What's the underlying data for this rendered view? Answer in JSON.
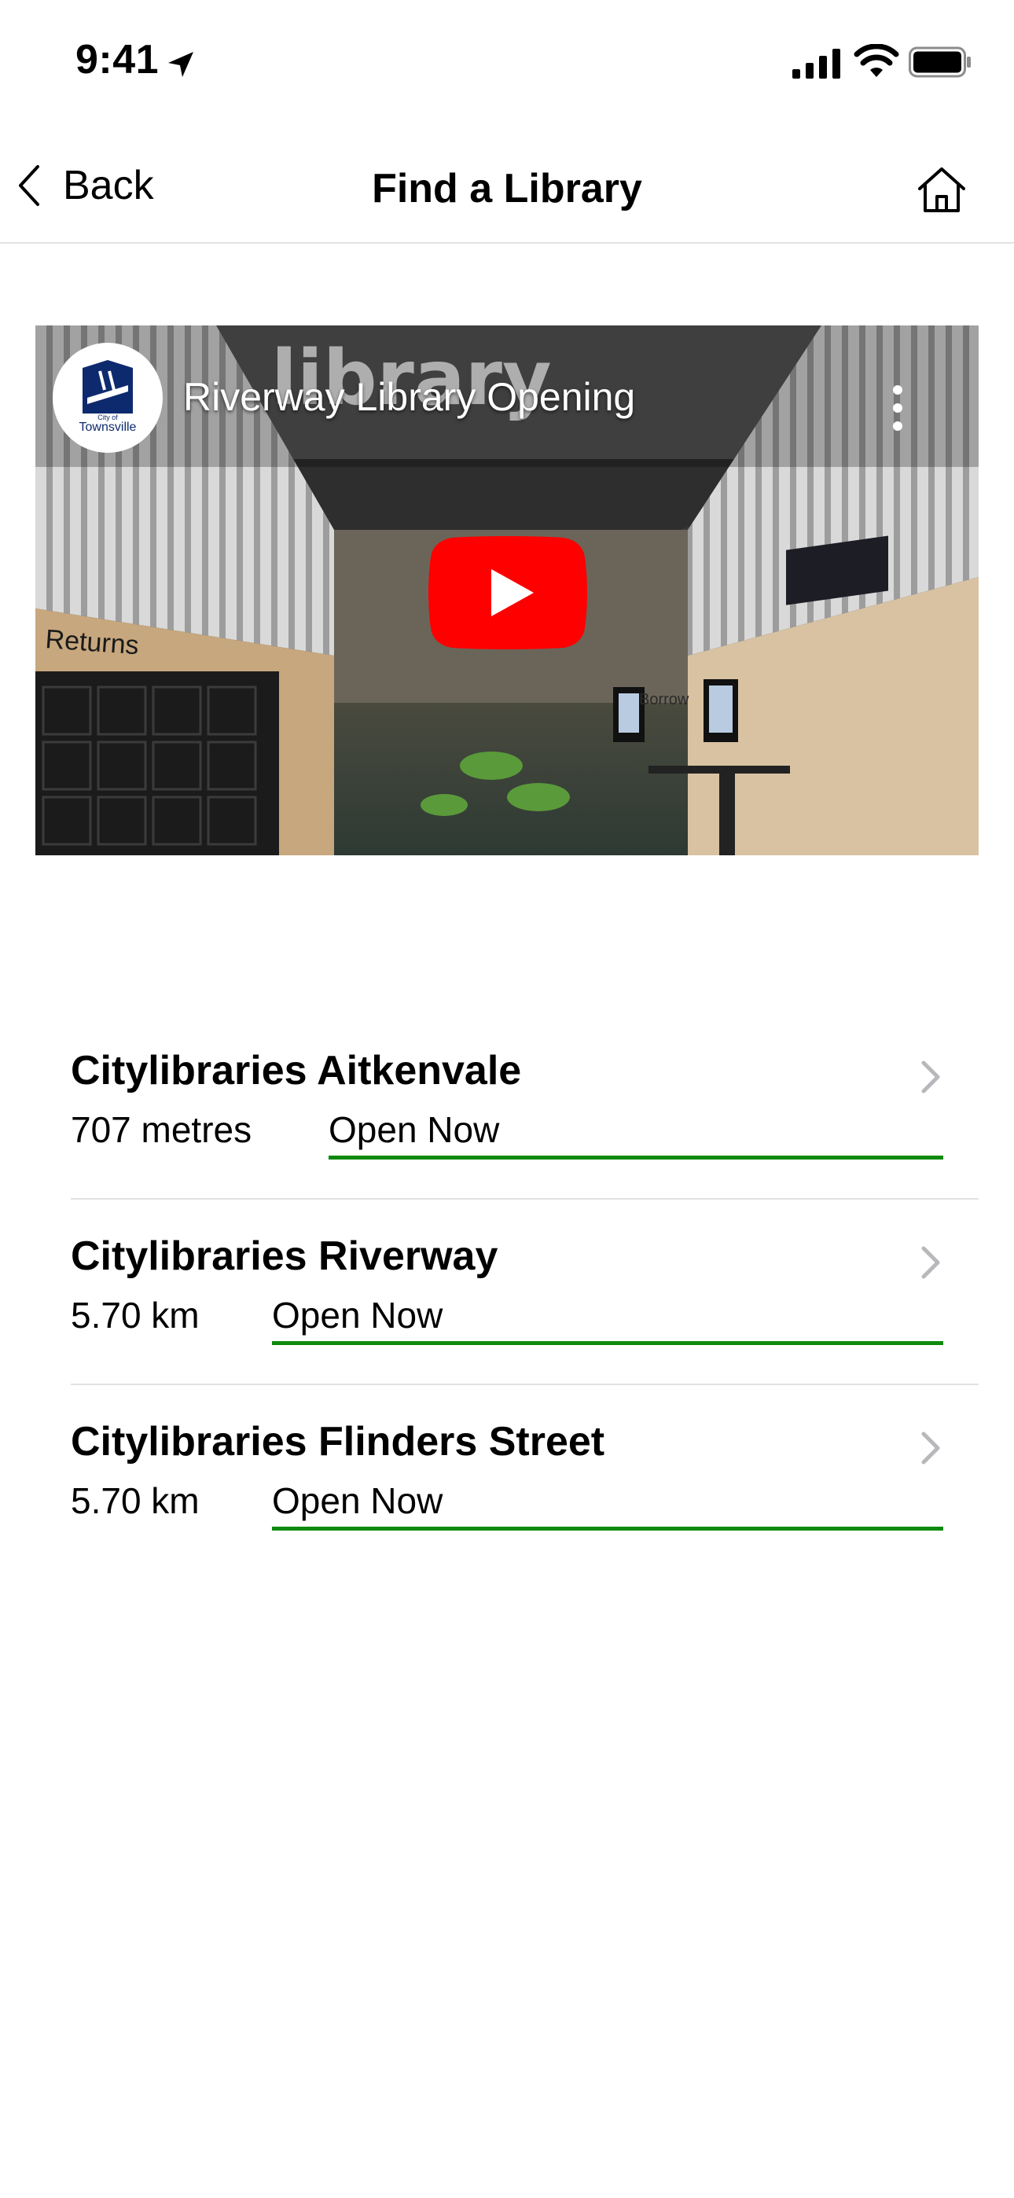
{
  "status_bar": {
    "time": "9:41",
    "icons": [
      "location-arrow-icon",
      "cellular-signal-icon",
      "wifi-icon",
      "battery-icon"
    ]
  },
  "nav": {
    "back_label": "Back",
    "title": "Find a Library",
    "icons": [
      "back-chevron-icon",
      "home-icon"
    ]
  },
  "video": {
    "title": "Riverway Library Opening",
    "channel_logo_text": "City of Townsville",
    "scene_text": [
      "library",
      "Returns",
      "Borrow"
    ],
    "play_icon": "youtube-play-icon"
  },
  "libraries": [
    {
      "name": "Citylibraries Aitkenvale",
      "distance": "707 metres",
      "status": "Open Now"
    },
    {
      "name": "Citylibraries Riverway",
      "distance": "5.70 km",
      "status": "Open Now"
    },
    {
      "name": "Citylibraries Flinders Street",
      "distance": "5.70 km",
      "status": "Open Now"
    }
  ],
  "colors": {
    "status_open": "#0e8a0e",
    "divider": "#e2e2e4",
    "youtube_red": "#ff0000"
  }
}
